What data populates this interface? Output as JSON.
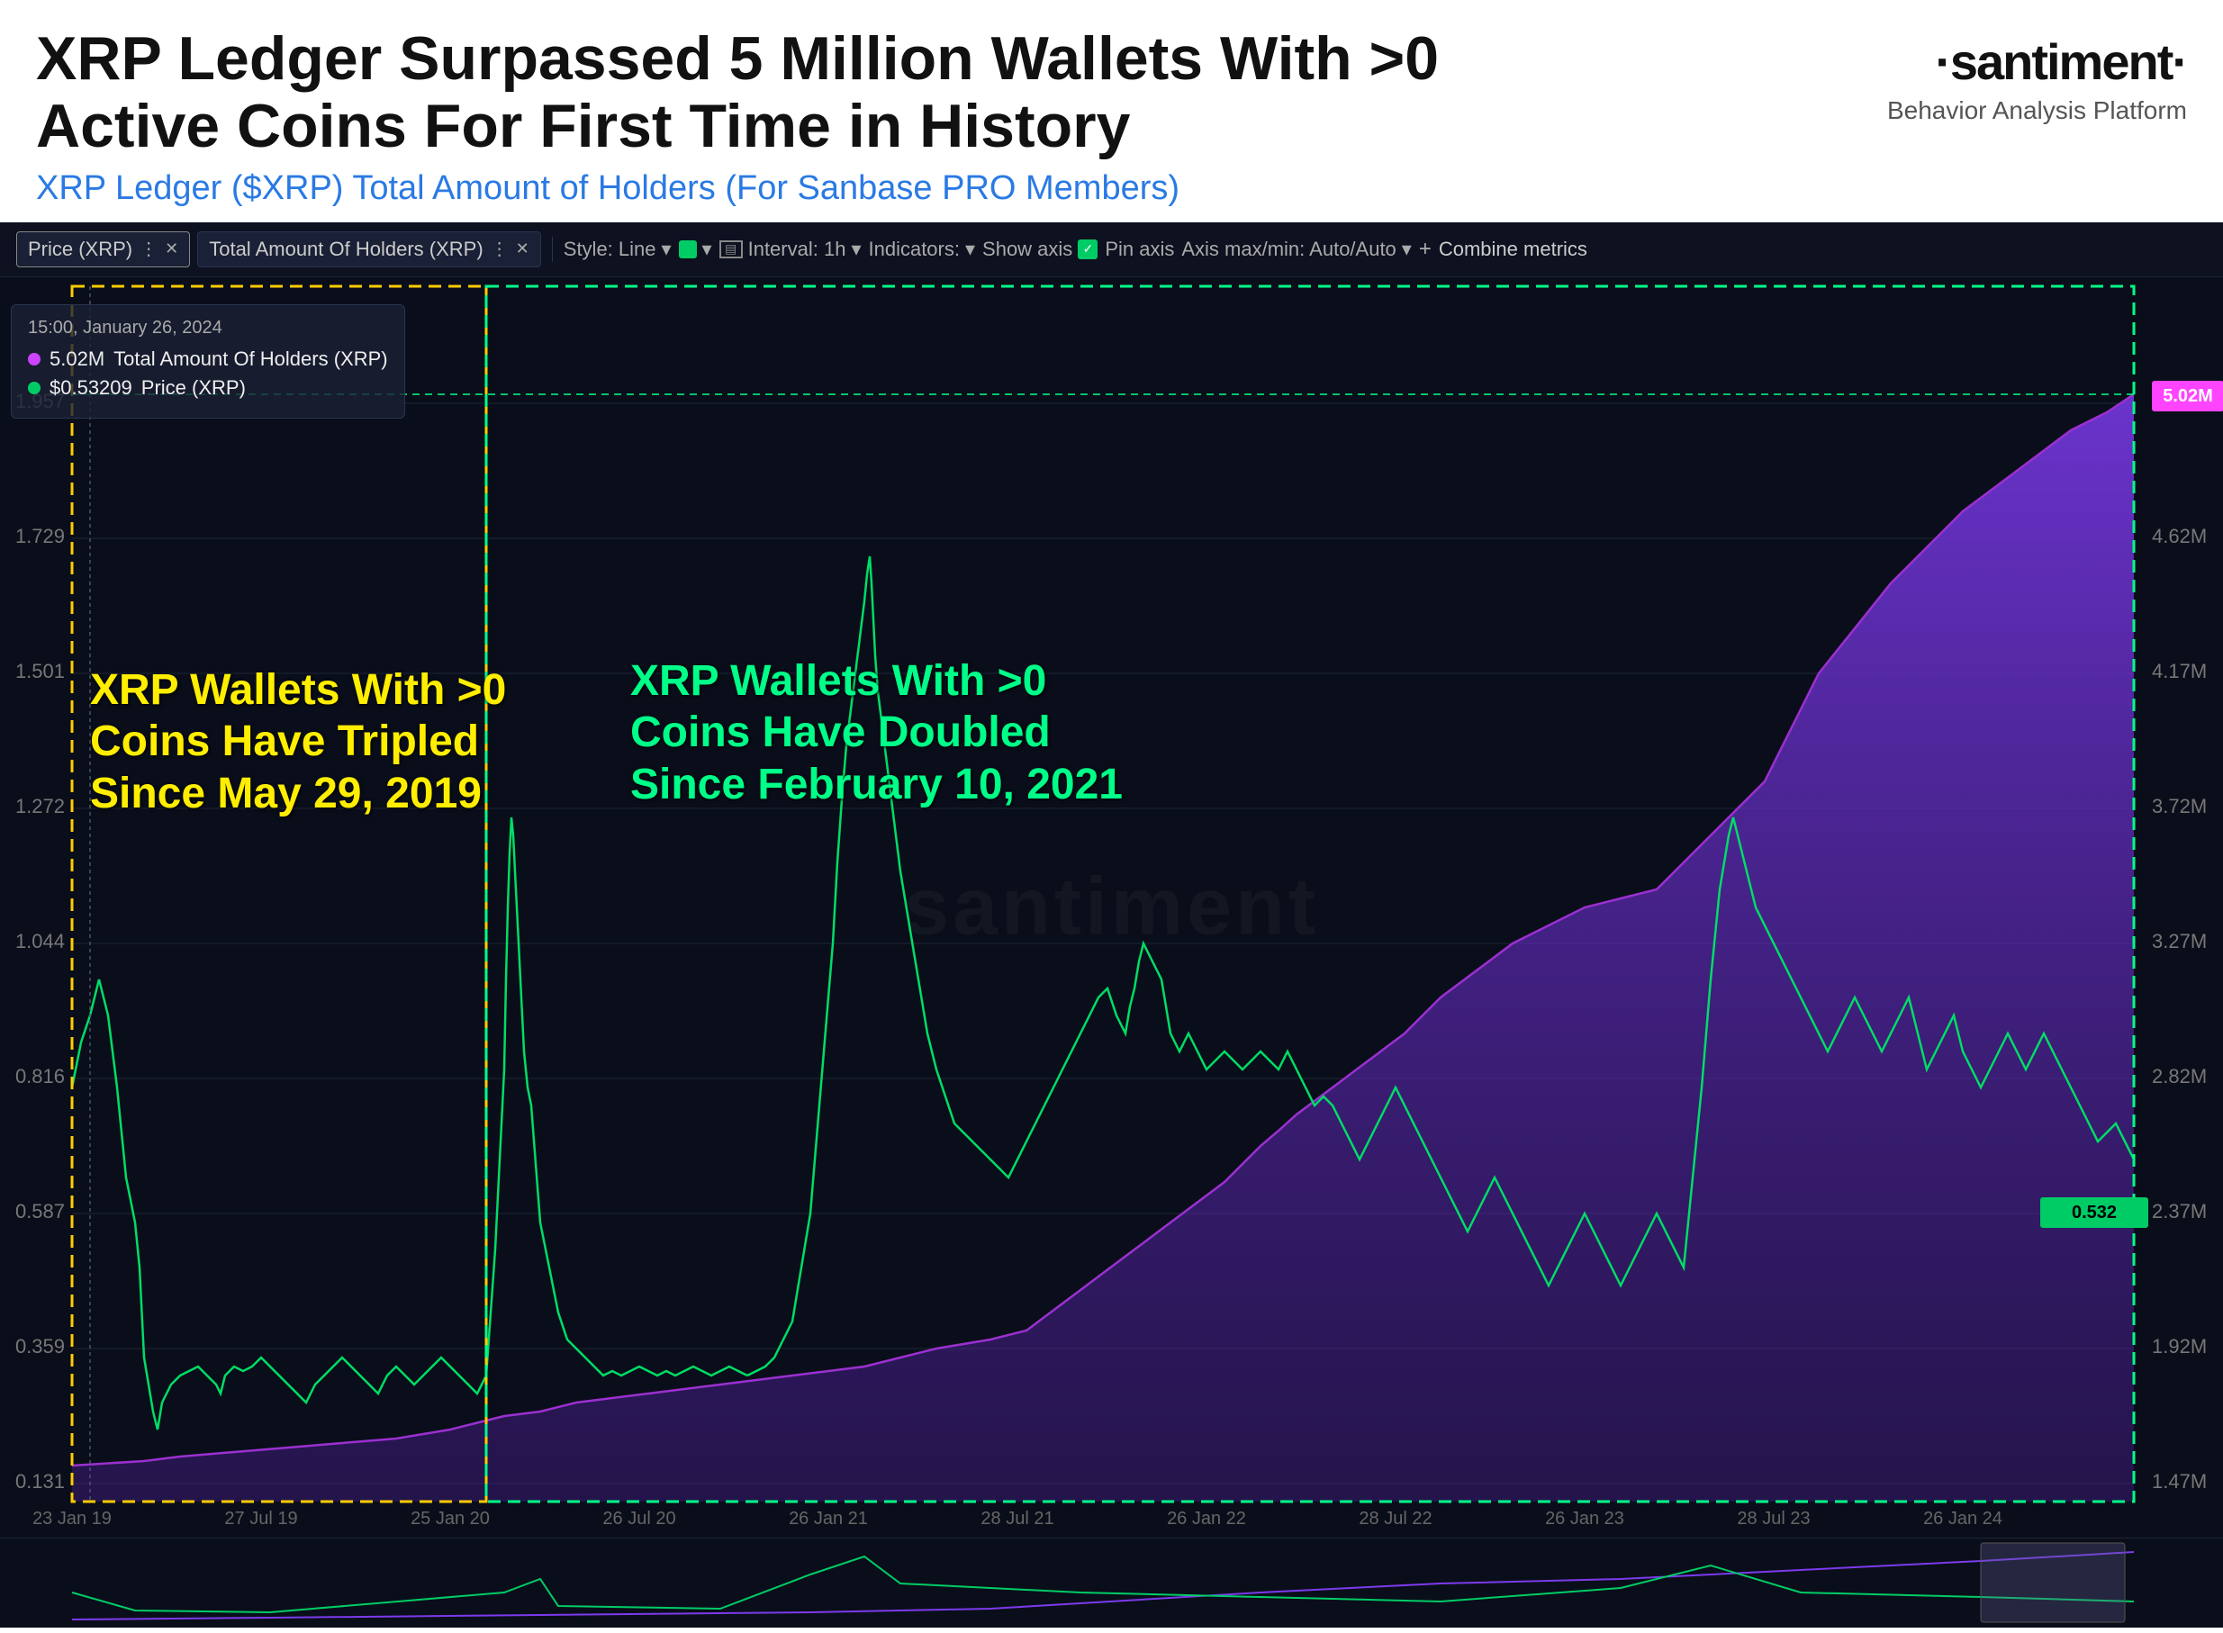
{
  "header": {
    "main_title": "XRP Ledger Surpassed 5 Million Wallets With >0 Active Coins For First Time in History",
    "subtitle": "XRP Ledger ($XRP) Total Amount of Holders (For Sanbase PRO Members)",
    "logo": "·santiment·",
    "logo_left_dot": "·",
    "logo_right_dot": "·",
    "logo_text": "santiment",
    "behavior_platform": "Behavior Analysis Platform"
  },
  "toolbar": {
    "metric1_label": "Price (XRP)",
    "metric2_label": "Total Amount Of Holders (XRP)",
    "style_label": "Style: Line",
    "color_label": "",
    "interval_label": "Interval: 1h",
    "indicators_label": "Indicators:",
    "show_axis_label": "Show axis",
    "pin_axis_label": "Pin axis",
    "axis_minmax_label": "Axis max/min: Auto/Auto",
    "combine_label": "Combine metrics",
    "plus_label": "+"
  },
  "tooltip": {
    "date": "15:00, January 26, 2024",
    "holders_value": "5.02M",
    "holders_label": "Total Amount Of Holders (XRP)",
    "price_value": "$0.53209",
    "price_label": "Price (XRP)"
  },
  "annotations": {
    "yellow_text": "XRP Wallets With >0 Coins Have Tripled Since May 29, 2019",
    "green_text": "XRP Wallets With >0 Coins Have Doubled Since February 10, 2021"
  },
  "y_axis_left": {
    "values": [
      "1.957",
      "1.729",
      "1.501",
      "1.272",
      "1.044",
      "0.816",
      "0.587",
      "0.359",
      "0.131"
    ]
  },
  "y_axis_right": {
    "values": [
      "5.02M",
      "4.62M",
      "4.17M",
      "3.72M",
      "3.27M",
      "2.82M",
      "2.37M",
      "1.92M",
      "1.47M"
    ]
  },
  "x_axis": {
    "labels": [
      "23 Jan 19",
      "27 Jul 19",
      "25 Jan 20",
      "26 Jul 20",
      "26 Jan 21",
      "28 Jul 21",
      "26 Jan 22",
      "28 Jul 22",
      "26 Jan 23",
      "28 Jul 23",
      "26 Jan 24"
    ]
  },
  "badges": {
    "price_badge": "0.532",
    "holders_badge": "5.02M"
  },
  "colors": {
    "background": "#0a0e1a",
    "toolbar_bg": "#0d1120",
    "price_line": "#cc44ff",
    "holders_line": "#00cc66",
    "holders_fill": "#6b21a8",
    "annotation_yellow": "#ffee00",
    "annotation_green": "#00ff88",
    "dashed_box": "#ffcc00",
    "accent_green": "#00cc66"
  }
}
